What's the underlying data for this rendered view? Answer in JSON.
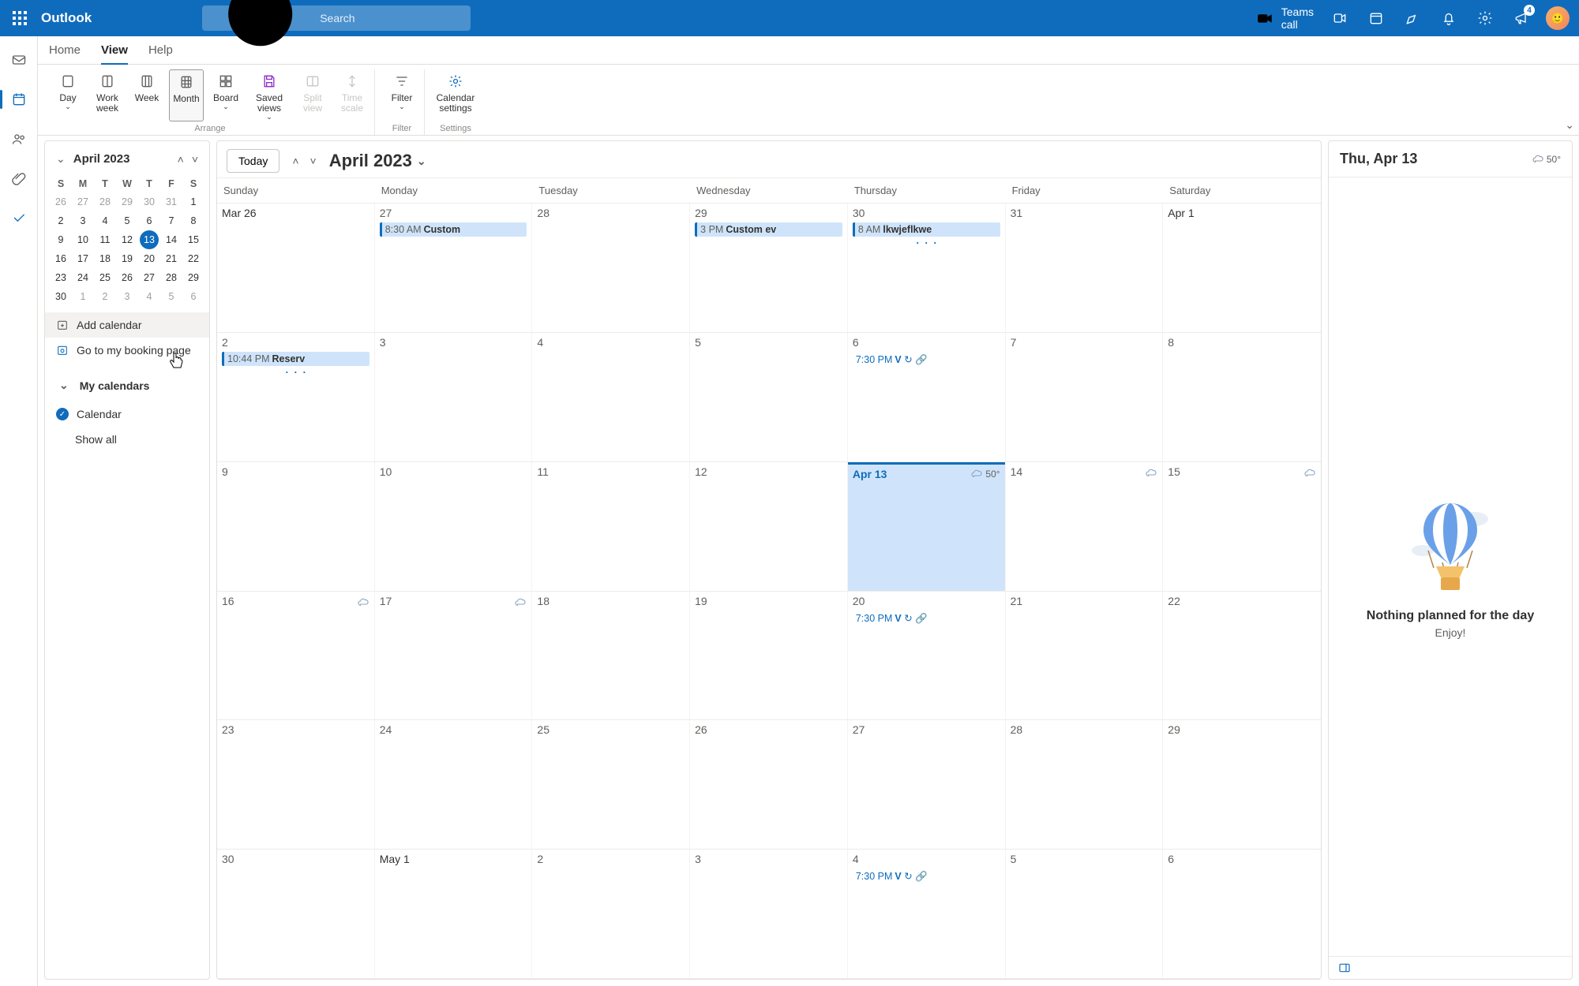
{
  "topbar": {
    "brand": "Outlook",
    "search_placeholder": "Search",
    "teams_call_label": "Teams call",
    "notification_badge": "4"
  },
  "ribbon": {
    "tabs": [
      "Home",
      "View",
      "Help"
    ],
    "active_tab": "View",
    "arrange": {
      "label": "Arrange",
      "items": [
        "Day",
        "Work week",
        "Week",
        "Month",
        "Board",
        "Saved views",
        "Split view",
        "Time scale"
      ],
      "selected": "Month"
    },
    "filter_group": {
      "label": "Filter",
      "item": "Filter"
    },
    "settings_group": {
      "label": "Settings",
      "item": "Calendar settings"
    }
  },
  "mini_calendar": {
    "title": "April 2023",
    "dow": [
      "S",
      "M",
      "T",
      "W",
      "T",
      "F",
      "S"
    ],
    "weeks": [
      [
        {
          "n": "26",
          "o": true
        },
        {
          "n": "27",
          "o": true
        },
        {
          "n": "28",
          "o": true
        },
        {
          "n": "29",
          "o": true
        },
        {
          "n": "30",
          "o": true
        },
        {
          "n": "31",
          "o": true
        },
        {
          "n": "1"
        }
      ],
      [
        {
          "n": "2"
        },
        {
          "n": "3"
        },
        {
          "n": "4"
        },
        {
          "n": "5"
        },
        {
          "n": "6"
        },
        {
          "n": "7"
        },
        {
          "n": "8"
        }
      ],
      [
        {
          "n": "9"
        },
        {
          "n": "10"
        },
        {
          "n": "11"
        },
        {
          "n": "12"
        },
        {
          "n": "13",
          "today": true
        },
        {
          "n": "14"
        },
        {
          "n": "15"
        }
      ],
      [
        {
          "n": "16"
        },
        {
          "n": "17"
        },
        {
          "n": "18"
        },
        {
          "n": "19"
        },
        {
          "n": "20"
        },
        {
          "n": "21"
        },
        {
          "n": "22"
        }
      ],
      [
        {
          "n": "23"
        },
        {
          "n": "24"
        },
        {
          "n": "25"
        },
        {
          "n": "26"
        },
        {
          "n": "27"
        },
        {
          "n": "28"
        },
        {
          "n": "29"
        }
      ],
      [
        {
          "n": "30"
        },
        {
          "n": "1",
          "o": true
        },
        {
          "n": "2",
          "o": true
        },
        {
          "n": "3",
          "o": true
        },
        {
          "n": "4",
          "o": true
        },
        {
          "n": "5",
          "o": true
        },
        {
          "n": "6",
          "o": true
        }
      ]
    ]
  },
  "sidebar": {
    "add_calendar": "Add calendar",
    "booking_page": "Go to my booking page",
    "group_header": "My calendars",
    "calendars": [
      "Calendar"
    ],
    "show_all": "Show all"
  },
  "cal": {
    "today_btn": "Today",
    "title": "April 2023",
    "dow": [
      "Sunday",
      "Monday",
      "Tuesday",
      "Wednesday",
      "Thursday",
      "Friday",
      "Saturday"
    ],
    "today_weather": "50°",
    "cells": [
      {
        "date": "Mar 26"
      },
      {
        "date": "27",
        "events": [
          {
            "time": "8:30 AM",
            "title": "Custom"
          }
        ]
      },
      {
        "date": "28"
      },
      {
        "date": "29",
        "events": [
          {
            "time": "3 PM",
            "title": "Custom ev"
          }
        ]
      },
      {
        "date": "30",
        "events": [
          {
            "time": "8 AM",
            "title": "lkwjeflkwe"
          }
        ],
        "more": true
      },
      {
        "date": "31"
      },
      {
        "date": "Apr 1"
      },
      {
        "date": "2",
        "events": [
          {
            "time": "10:44 PM",
            "title": "Reserv"
          }
        ],
        "more": true
      },
      {
        "date": "3"
      },
      {
        "date": "4"
      },
      {
        "date": "5"
      },
      {
        "date": "6",
        "events": [
          {
            "time": "7:30 PM",
            "title": "V",
            "link": true,
            "recur": true
          }
        ]
      },
      {
        "date": "7"
      },
      {
        "date": "8"
      },
      {
        "date": "9"
      },
      {
        "date": "10"
      },
      {
        "date": "11"
      },
      {
        "date": "12"
      },
      {
        "date": "Apr 13",
        "today": true,
        "weather": "50°"
      },
      {
        "date": "14",
        "wicon": true
      },
      {
        "date": "15",
        "wicon": true
      },
      {
        "date": "16",
        "wicon": true
      },
      {
        "date": "17",
        "wicon": true
      },
      {
        "date": "18"
      },
      {
        "date": "19"
      },
      {
        "date": "20",
        "events": [
          {
            "time": "7:30 PM",
            "title": "V",
            "link": true,
            "recur": true
          }
        ]
      },
      {
        "date": "21"
      },
      {
        "date": "22"
      },
      {
        "date": "23"
      },
      {
        "date": "24"
      },
      {
        "date": "25"
      },
      {
        "date": "26"
      },
      {
        "date": "27"
      },
      {
        "date": "28"
      },
      {
        "date": "29"
      },
      {
        "date": "30"
      },
      {
        "date": "May 1"
      },
      {
        "date": "2"
      },
      {
        "date": "3"
      },
      {
        "date": "4",
        "events": [
          {
            "time": "7:30 PM",
            "title": "V",
            "link": true,
            "recur": true
          }
        ]
      },
      {
        "date": "5"
      },
      {
        "date": "6"
      }
    ]
  },
  "daypane": {
    "title": "Thu, Apr 13",
    "weather": "50°",
    "empty_title": "Nothing planned for the day",
    "empty_sub": "Enjoy!"
  }
}
